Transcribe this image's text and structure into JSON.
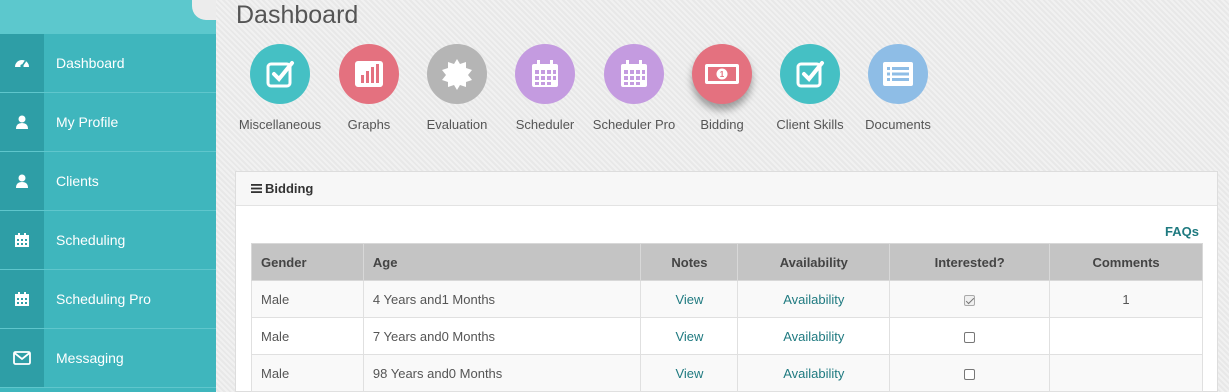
{
  "page": {
    "title": "Dashboard"
  },
  "sidebar": {
    "items": [
      {
        "label": "Dashboard",
        "icon": "dashboard-icon"
      },
      {
        "label": "My Profile",
        "icon": "user-icon"
      },
      {
        "label": "Clients",
        "icon": "user-icon"
      },
      {
        "label": "Scheduling",
        "icon": "calendar-icon"
      },
      {
        "label": "Scheduling Pro",
        "icon": "calendar-icon"
      },
      {
        "label": "Messaging",
        "icon": "envelope-icon"
      }
    ]
  },
  "tiles": [
    {
      "label": "Miscellaneous",
      "icon": "checkbox-icon",
      "color": "#45c0c4"
    },
    {
      "label": "Graphs",
      "icon": "bar-chart-icon",
      "color": "#e4717f"
    },
    {
      "label": "Evaluation",
      "icon": "badge-icon",
      "color": "#b5b5b5"
    },
    {
      "label": "Scheduler",
      "icon": "calendar-icon",
      "color": "#c49be0"
    },
    {
      "label": "Scheduler Pro",
      "icon": "calendar-icon",
      "color": "#c49be0"
    },
    {
      "label": "Bidding",
      "icon": "money-icon",
      "color": "#e4717f",
      "active": true
    },
    {
      "label": "Client Skills",
      "icon": "checkbox-icon",
      "color": "#45c0c4"
    },
    {
      "label": "Documents",
      "icon": "list-icon",
      "color": "#8ebde6"
    }
  ],
  "panel": {
    "title": "Bidding",
    "faqs_label": "FAQs",
    "columns": [
      "Gender",
      "Age",
      "Notes",
      "Availability",
      "Interested?",
      "Comments"
    ],
    "rows": [
      {
        "gender": "Male",
        "age": "4 Years and1 Months",
        "notes": "View",
        "availability": "Availability",
        "interested": true,
        "comments": "1"
      },
      {
        "gender": "Male",
        "age": "7 Years and0 Months",
        "notes": "View",
        "availability": "Availability",
        "interested": false,
        "comments": ""
      },
      {
        "gender": "Male",
        "age": "98 Years and0 Months",
        "notes": "View",
        "availability": "Availability",
        "interested": false,
        "comments": ""
      }
    ]
  }
}
